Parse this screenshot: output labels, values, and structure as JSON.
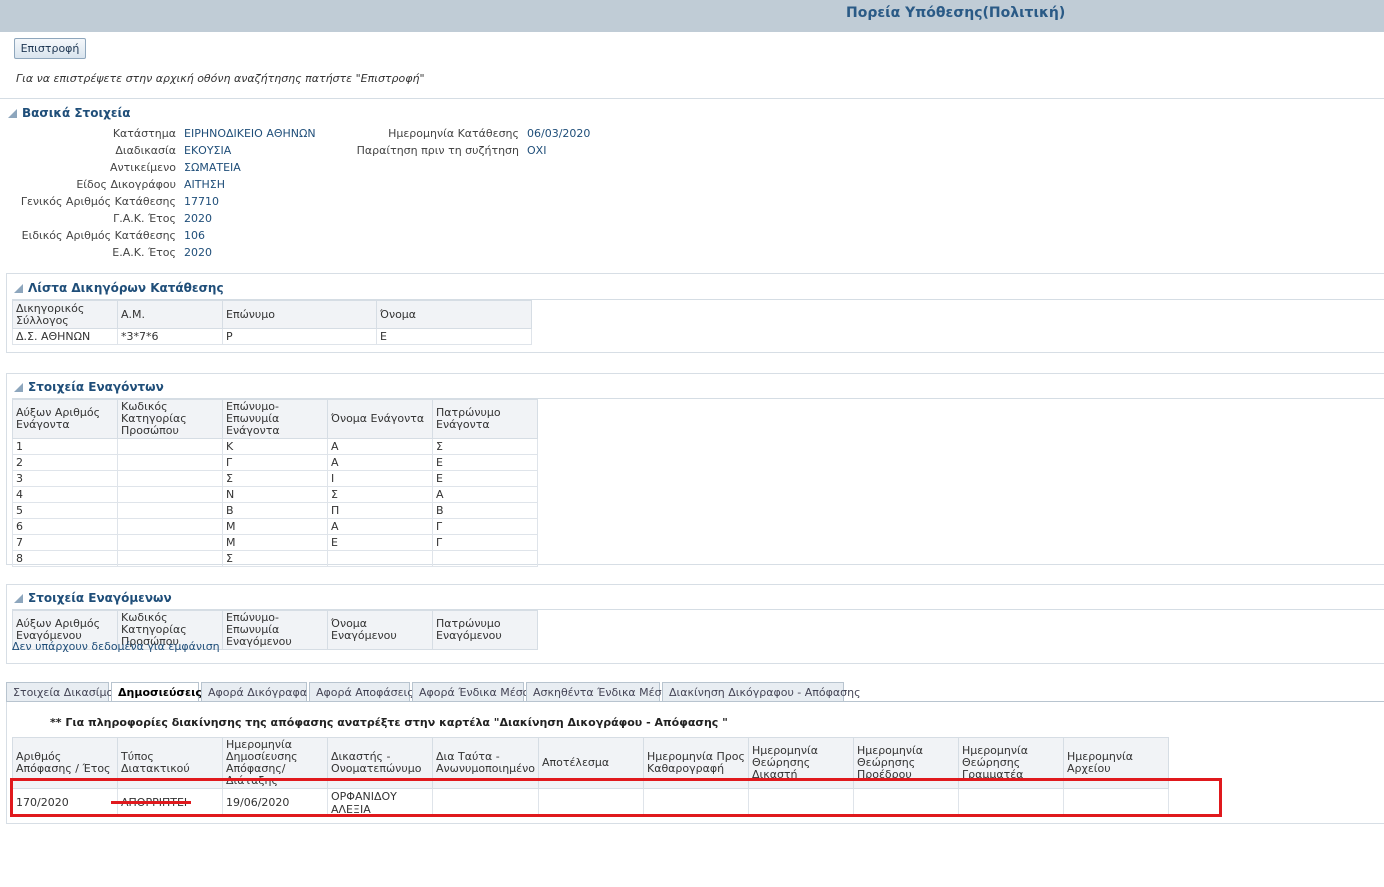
{
  "page": {
    "title": "Πορεία Υπόθεσης(Πολιτική)",
    "back_button": "Επιστροφή",
    "hint": "Για να επιστρέψετε στην αρχική οθόνη αναζήτησης πατήστε \"Επιστροφή\""
  },
  "basic": {
    "title": "Βασικά Στοιχεία",
    "left": [
      {
        "label": "Κατάστημα",
        "value": "ΕΙΡΗΝΟΔΙΚΕΙΟ ΑΘΗΝΩΝ"
      },
      {
        "label": "Διαδικασία",
        "value": "ΕΚΟΥΣΙΑ"
      },
      {
        "label": "Αντικείμενο",
        "value": "ΣΩΜΑΤΕΙΑ"
      },
      {
        "label": "Είδος Δικογράφου",
        "value": "ΑΙΤΗΣΗ"
      },
      {
        "label": "Γενικός Αριθμός Κατάθεσης",
        "value": "17710"
      },
      {
        "label": "Γ.Α.Κ. Έτος",
        "value": "2020"
      },
      {
        "label": "Ειδικός Αριθμός Κατάθεσης",
        "value": "106"
      },
      {
        "label": "Ε.Α.Κ. Έτος",
        "value": "2020"
      }
    ],
    "right": [
      {
        "label": "Ημερομηνία Κατάθεσης",
        "value": "06/03/2020"
      },
      {
        "label": "Παραίτηση πριν τη συζήτηση",
        "value": "ΟΧΙ"
      }
    ]
  },
  "lawyers": {
    "title": "Λίστα Δικηγόρων Κατάθεσης",
    "headers": [
      "Δικηγορικός Σύλλογος",
      "Α.Μ.",
      "Επώνυμο",
      "Όνομα"
    ],
    "rows": [
      [
        "Δ.Σ. ΑΘΗΝΩΝ",
        "*3*7*6",
        "Ρ",
        "Ε"
      ]
    ]
  },
  "plaintiffs": {
    "title": "Στοιχεία Εναγόντων",
    "headers": [
      "Αύξων Αριθμός Ενάγοντα",
      "Κωδικός Κατηγορίας Προσώπου",
      "Επώνυμο-Επωνυμία Ενάγοντα",
      "Όνομα Ενάγοντα",
      "Πατρώνυμο Ενάγοντα"
    ],
    "rows": [
      [
        "1",
        "",
        "Κ",
        "Α",
        "Σ"
      ],
      [
        "2",
        "",
        "Γ",
        "Α",
        "Ε"
      ],
      [
        "3",
        "",
        "Σ",
        "Ι",
        "Ε"
      ],
      [
        "4",
        "",
        "Ν",
        "Σ",
        "Α"
      ],
      [
        "5",
        "",
        "Β",
        "Π",
        "Β"
      ],
      [
        "6",
        "",
        "Μ",
        "Α",
        "Γ"
      ],
      [
        "7",
        "",
        "Μ",
        "Ε",
        "Γ"
      ],
      [
        "8",
        "",
        "Σ",
        "",
        ""
      ]
    ]
  },
  "defendants": {
    "title": "Στοιχεία Εναγόμενων",
    "headers": [
      "Αύξων Αριθμός Εναγόμενου",
      "Κωδικός Κατηγορίας Προσώπου",
      "Επώνυμο-Επωνυμία Εναγόμενου",
      "Όνομα Εναγόμενου",
      "Πατρώνυμο Εναγόμενου"
    ],
    "empty": "Δεν υπάρχουν δεδομένα για εμφάνιση"
  },
  "tabs": [
    "Στοιχεία Δικασίμου",
    "Δημοσιεύσεις",
    "Αφορά Δικόγραφα",
    "Αφορά Αποφάσεις",
    "Αφορά Ένδικα Μέσα",
    "Ασκηθέντα Ένδικα Μέσα",
    "Διακίνηση Δικόγραφου - Απόφασης"
  ],
  "active_tab": "Δημοσιεύσεις",
  "publications": {
    "note": "** Για πληροφορίες διακίνησης της απόφασης ανατρέξτε στην καρτέλα \"Διακίνηση Δικογράφου - Απόφασης \"",
    "headers": [
      "Αριθμός Απόφασης / Έτος",
      "Τύπος Διατακτικού",
      "Ημερομηνία Δημοσίευσης Απόφασης/Διάταξης",
      "Δικαστής - Ονοματεπώνυμο",
      "Δια Ταύτα - Ανωνυμοποιημένο",
      "Αποτέλεσμα",
      "Ημερομηνία Προς Καθαρογραφή",
      "Ημερομηνία Θεώρησης Δικαστή",
      "Ημερομηνία Θεώρησης Προέδρου",
      "Ημερομηνία Θεώρησης Γραμματέα",
      "Ημερομηνία Αρχείου"
    ],
    "rows": [
      [
        "170/2020",
        "ΑΠΟΡΡΙΠΤΕΙ",
        "19/06/2020",
        "ΟΡΦΑΝΙΔΟΥ ΑΛΕΞΙΑ",
        "",
        "",
        "",
        "",
        "",
        "",
        ""
      ]
    ]
  },
  "colors": {
    "header_bar": "#c0ccd6",
    "title": "#2a5a86",
    "link": "#1f4e79",
    "highlight": "#e0191d"
  }
}
